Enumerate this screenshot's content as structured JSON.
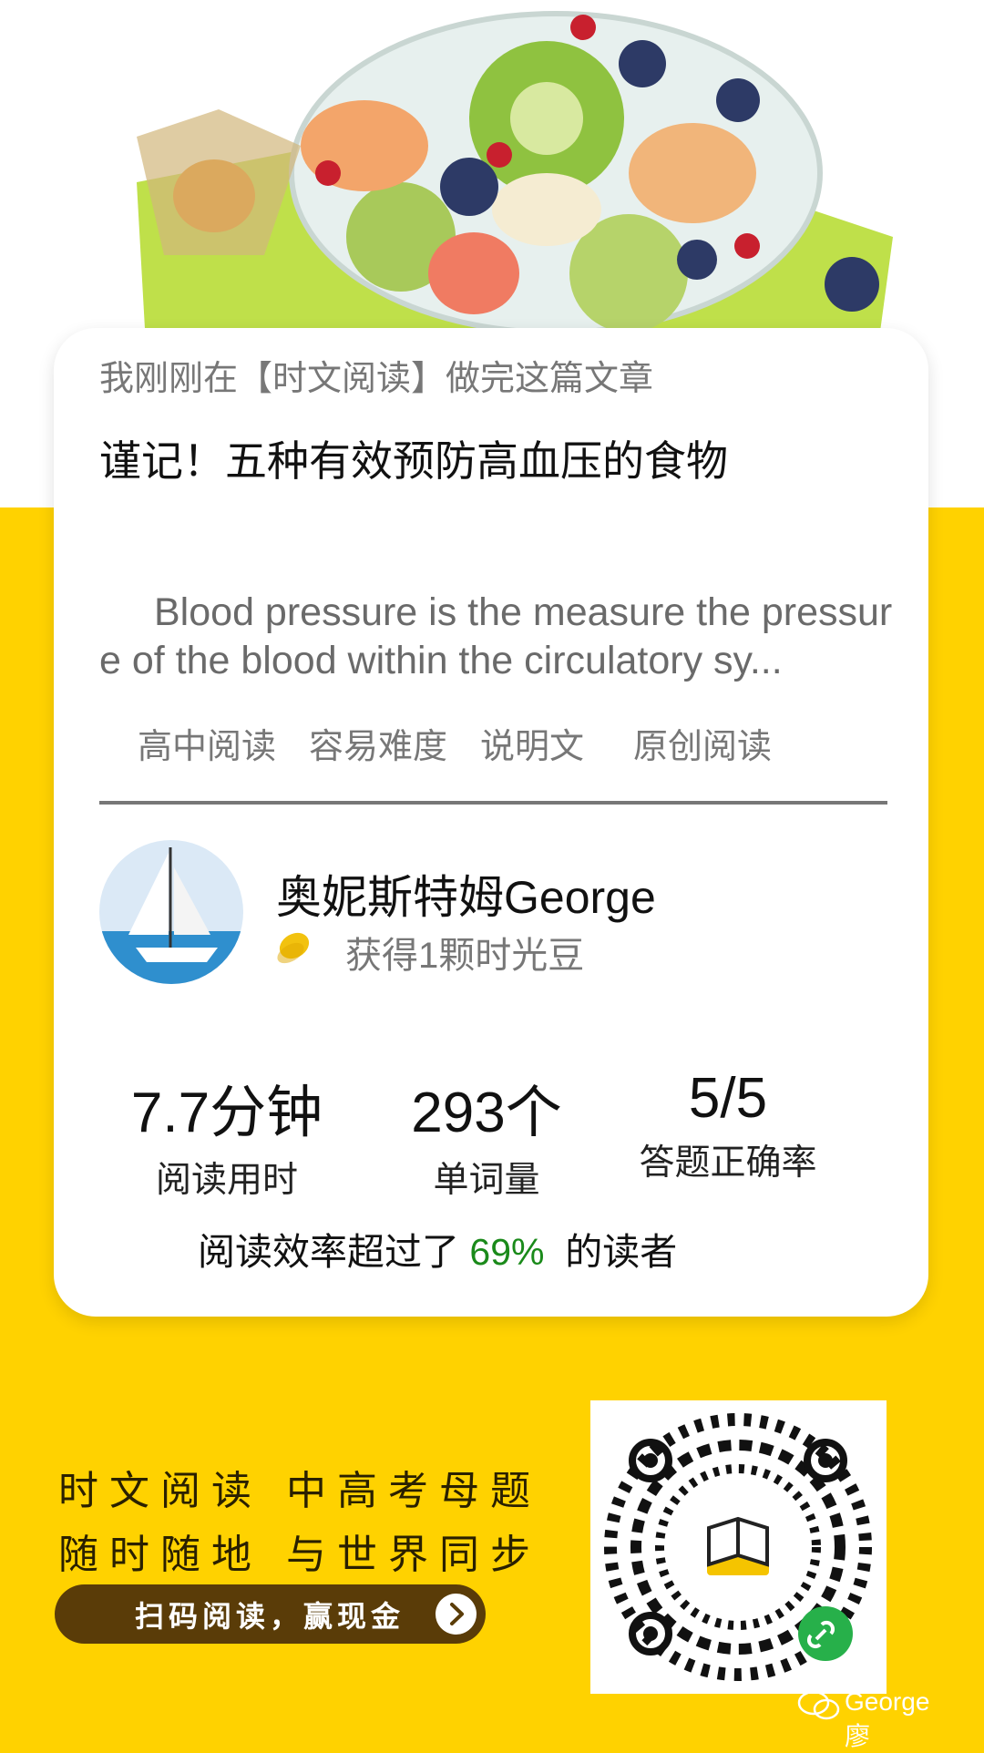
{
  "header": {
    "image": "fruit-salad-bowl"
  },
  "card": {
    "intro": "我刚刚在【时文阅读】做完这篇文章",
    "title": "谨记！五种有效预防高血压的食物",
    "excerpt": "Blood pressure is the measure the pressure of the blood within the circulatory sy...",
    "tags": [
      "高中阅读",
      "容易难度",
      "说明文",
      "原创阅读"
    ],
    "user": {
      "name": "奥妮斯特姆George",
      "reward": "获得1颗时光豆",
      "reward_icon": "bean-icon",
      "avatar_icon": "sailboat-avatar"
    },
    "stats": [
      {
        "value": "7.7分钟",
        "label": "阅读用时"
      },
      {
        "value": "293个",
        "label": "单词量"
      },
      {
        "value": "5/5",
        "label": "答题正确率"
      }
    ],
    "efficiency": {
      "prefix": "阅读效率超过了 ",
      "percent": "69%",
      "suffix": "  的读者"
    }
  },
  "promo": {
    "line1": "时文阅读 中高考母题",
    "line2": "随时随地 与世界同步",
    "button": "扫码阅读，赢现金",
    "button_icon": "arrow-right-icon",
    "qr_icon": "mini-program-qr"
  },
  "watermark": {
    "text": "George廖",
    "icon": "wechat-icon"
  },
  "colors": {
    "background": "#ffd200",
    "card": "#ffffff",
    "accent_green": "#1a8a1a",
    "button": "#5a3c08"
  }
}
